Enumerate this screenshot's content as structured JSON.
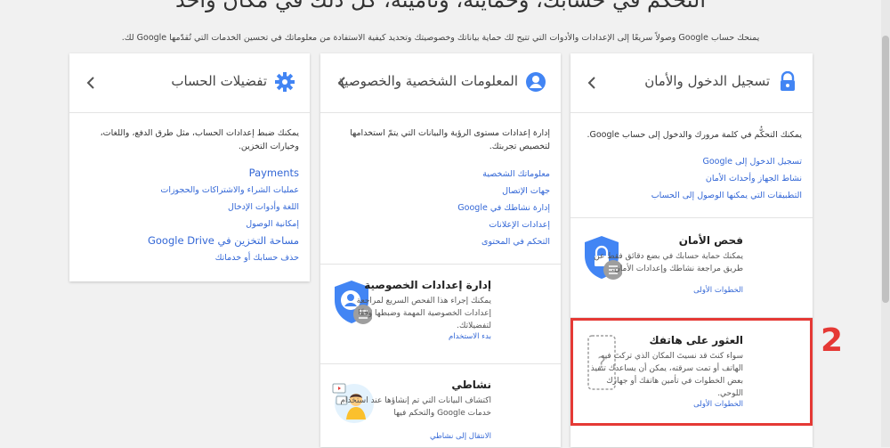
{
  "header": {
    "headline": "التحكم في حسابك، وحمايته، وتأمينه، كل ذلك في مكان واحد",
    "subline": "يمنحك حساب Google وصولاً سريعًا إلى الإعدادات والأدوات التي تتيح لك حماية بياناتك وخصوصيتك وتحديد كيفية الاستفادة من معلوماتك في تحسين الخدمات التي تُقدّمها Google لك."
  },
  "cards": {
    "signin": {
      "title": "تسجيل الدخول والأمان",
      "desc": "يمكنك التحكُّم في كلمة مرورك والدخول إلى حساب Google.",
      "links": [
        "تسجيل الدخول إلى Google",
        "نشاط الجهاز وأحداث الأمان",
        "التطبيقات التي يمكنها الوصول إلى الحساب"
      ],
      "checkup": {
        "title": "فحص الأمان",
        "desc": "يمكنك حماية حسابك في بضع دقائق فقط عن طريق مراجعة نشاطك وإعدادات الأمان.",
        "link": "الخطوات الأولى"
      },
      "find_phone": {
        "title": "العثور على هاتفك",
        "desc": "سواء كنتَ قد نسيتَ المكان الذي تركتَ فيه الهاتف أو تمت سرقته، يمكن أن يساعدك تنفيذ بعض الخطوات في تأمين هاتفك أو جهازك اللوحي.",
        "link": "الخطوات الأولى"
      }
    },
    "personal": {
      "title": "المعلومات الشخصية والخصوصية",
      "desc": "إدارة إعدادات مستوى الرؤية والبيانات التي يتمّ استخدامها لتخصيص تجربتك.",
      "links": [
        "معلوماتك الشخصية",
        "جهات الإتصال",
        "إدارة نشاطك في Google",
        "إعدادات الإعلانات",
        "التحكم في المحتوى"
      ],
      "privacy_checkup": {
        "title": "إدارة إعدادات الخصوصية",
        "desc": "يمكنك إجراء هذا الفحص السريع لمراجعة إعدادات الخصوصية المهمة وضبطها وفقًا لتفضيلاتك.",
        "link": "بدء الاستخدام"
      },
      "my_activity": {
        "title": "نشاطي",
        "desc": "اكتشاف البيانات التي تم إنشاؤها عند استخدام خدمات Google والتحكم فيها",
        "link": "الانتقال إلى نشاطي"
      }
    },
    "prefs": {
      "title": "تفضيلات الحساب",
      "desc": "يمكنك ضبط إعدادات الحساب، مثل طرق الدفع، واللغات، وخيارات التخزين.",
      "links": [
        "Payments",
        "عمليات الشراء والاشتراكات والحجوزات",
        "اللغة وأدوات الإدخال",
        "إمكانية الوصول",
        "مساحة التخزين في Google Drive",
        "حذف حسابك أو خدماتك"
      ]
    }
  },
  "annotation": {
    "number": "2"
  },
  "colors": {
    "accent": "#3367d6",
    "icon_blue": "#4285f4",
    "highlight": "#e53935"
  }
}
